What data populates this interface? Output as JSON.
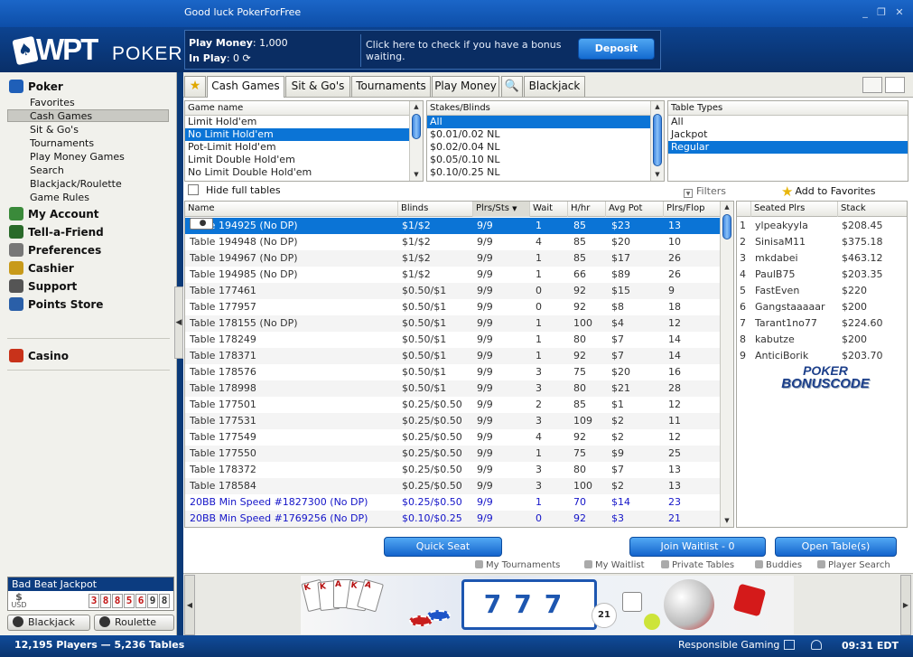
{
  "window": {
    "title": "Good luck PokerForFree",
    "minimize": "_",
    "restore": "❐",
    "close": "✕"
  },
  "brand": {
    "wpt": "WPT",
    "poker": "POKER"
  },
  "account": {
    "play_money_label": "Play Money",
    "play_money_value": "1,000",
    "in_play_label": "In Play",
    "in_play_value": "0",
    "bonus_text": "Click here to check if you have a bonus waiting.",
    "deposit_label": "Deposit"
  },
  "sidebar": {
    "poker": "Poker",
    "items": [
      "Favorites",
      "Cash Games",
      "Sit & Go's",
      "Tournaments",
      "Play Money Games",
      "Search",
      "Blackjack/Roulette",
      "Game Rules"
    ],
    "my_account": "My Account",
    "tell_a_friend": "Tell-a-Friend",
    "preferences": "Preferences",
    "cashier": "Cashier",
    "support": "Support",
    "points_store": "Points Store",
    "casino": "Casino",
    "jackpot": {
      "title": "Bad Beat Jackpot",
      "currency": "USD",
      "digits": [
        "3",
        "8",
        "8",
        "5",
        "6",
        "9",
        "8"
      ]
    },
    "blackjack_btn": "Blackjack",
    "roulette_btn": "Roulette"
  },
  "tabs": [
    "Cash Games",
    "Sit & Go's",
    "Tournaments",
    "Play Money",
    "Blackjack"
  ],
  "filters": {
    "game_header": "Game name",
    "games": [
      "Limit Hold'em",
      "No Limit Hold'em",
      "Pot-Limit Hold'em",
      "Limit Double Hold'em",
      "No Limit Double Hold'em"
    ],
    "game_selected": 1,
    "stakes_header": "Stakes/Blinds",
    "stakes": [
      "All",
      "$0.01/0.02 NL",
      "$0.02/0.04 NL",
      "$0.05/0.10 NL",
      "$0.10/0.25 NL"
    ],
    "stakes_selected": 0,
    "types_header": "Table Types",
    "types": [
      "All",
      "Jackpot",
      "Regular"
    ],
    "types_selected": 2
  },
  "hide_full_label": "Hide full tables",
  "filters_label": "Filters",
  "add_favorites_label": "Add to Favorites",
  "grid": {
    "headers": [
      "Name",
      "Blinds",
      "Plrs/Sts",
      "Wait",
      "H/hr",
      "Avg Pot",
      "Plrs/Flop"
    ],
    "rows": [
      {
        "name": "Table  194925 (No DP)",
        "blinds": "$1/$2",
        "plrs": "9/9",
        "wait": "1",
        "hhr": "85",
        "pot": "$23",
        "flop": "13"
      },
      {
        "name": "Table  194948 (No DP)",
        "blinds": "$1/$2",
        "plrs": "9/9",
        "wait": "4",
        "hhr": "85",
        "pot": "$20",
        "flop": "10"
      },
      {
        "name": "Table  194967 (No DP)",
        "blinds": "$1/$2",
        "plrs": "9/9",
        "wait": "1",
        "hhr": "85",
        "pot": "$17",
        "flop": "26"
      },
      {
        "name": "Table  194985 (No DP)",
        "blinds": "$1/$2",
        "plrs": "9/9",
        "wait": "1",
        "hhr": "66",
        "pot": "$89",
        "flop": "26"
      },
      {
        "name": "Table  177461",
        "blinds": "$0.50/$1",
        "plrs": "9/9",
        "wait": "0",
        "hhr": "92",
        "pot": "$15",
        "flop": "9"
      },
      {
        "name": "Table  177957",
        "blinds": "$0.50/$1",
        "plrs": "9/9",
        "wait": "0",
        "hhr": "92",
        "pot": "$8",
        "flop": "18"
      },
      {
        "name": "Table  178155 (No DP)",
        "blinds": "$0.50/$1",
        "plrs": "9/9",
        "wait": "1",
        "hhr": "100",
        "pot": "$4",
        "flop": "12"
      },
      {
        "name": "Table  178249",
        "blinds": "$0.50/$1",
        "plrs": "9/9",
        "wait": "1",
        "hhr": "80",
        "pot": "$7",
        "flop": "14"
      },
      {
        "name": "Table  178371",
        "blinds": "$0.50/$1",
        "plrs": "9/9",
        "wait": "1",
        "hhr": "92",
        "pot": "$7",
        "flop": "14"
      },
      {
        "name": "Table  178576",
        "blinds": "$0.50/$1",
        "plrs": "9/9",
        "wait": "3",
        "hhr": "75",
        "pot": "$20",
        "flop": "16"
      },
      {
        "name": "Table  178998",
        "blinds": "$0.50/$1",
        "plrs": "9/9",
        "wait": "3",
        "hhr": "80",
        "pot": "$21",
        "flop": "28"
      },
      {
        "name": "Table  177501",
        "blinds": "$0.25/$0.50",
        "plrs": "9/9",
        "wait": "2",
        "hhr": "85",
        "pot": "$1",
        "flop": "12"
      },
      {
        "name": "Table  177531",
        "blinds": "$0.25/$0.50",
        "plrs": "9/9",
        "wait": "3",
        "hhr": "109",
        "pot": "$2",
        "flop": "11"
      },
      {
        "name": "Table  177549",
        "blinds": "$0.25/$0.50",
        "plrs": "9/9",
        "wait": "4",
        "hhr": "92",
        "pot": "$2",
        "flop": "12"
      },
      {
        "name": "Table  177550",
        "blinds": "$0.25/$0.50",
        "plrs": "9/9",
        "wait": "1",
        "hhr": "75",
        "pot": "$9",
        "flop": "25"
      },
      {
        "name": "Table  178372",
        "blinds": "$0.25/$0.50",
        "plrs": "9/9",
        "wait": "3",
        "hhr": "80",
        "pot": "$7",
        "flop": "13"
      },
      {
        "name": "Table  178584",
        "blinds": "$0.25/$0.50",
        "plrs": "9/9",
        "wait": "3",
        "hhr": "100",
        "pot": "$2",
        "flop": "13"
      },
      {
        "name": "20BB Min Speed #1827300 (No DP)",
        "blinds": "$0.25/$0.50",
        "plrs": "9/9",
        "wait": "1",
        "hhr": "70",
        "pot": "$14",
        "flop": "23",
        "blue": true
      },
      {
        "name": "20BB Min Speed #1769256 (No DP)",
        "blinds": "$0.10/$0.25",
        "plrs": "9/9",
        "wait": "0",
        "hhr": "92",
        "pot": "$3",
        "flop": "21",
        "blue": true
      }
    ]
  },
  "seated": {
    "headers": [
      "Seated Plrs",
      "Stack"
    ],
    "rows": [
      {
        "seat": "1",
        "name": "ylpeakyyla",
        "stack": "$208.45"
      },
      {
        "seat": "2",
        "name": "SinisaM11",
        "stack": "$375.18"
      },
      {
        "seat": "3",
        "name": "mkdabei",
        "stack": "$463.12"
      },
      {
        "seat": "4",
        "name": "PaulB75",
        "stack": "$203.35"
      },
      {
        "seat": "5",
        "name": "FastEven",
        "stack": "$220"
      },
      {
        "seat": "6",
        "name": "Gangstaaaaar",
        "stack": "$200"
      },
      {
        "seat": "7",
        "name": "Tarant1no77",
        "stack": "$224.60"
      },
      {
        "seat": "8",
        "name": "kabutze",
        "stack": "$200"
      },
      {
        "seat": "9",
        "name": "AnticiBorik",
        "stack": "$203.70"
      }
    ],
    "watermark_l1": "POKER",
    "watermark_l2": "BONUSCODE"
  },
  "actions": {
    "quick_seat": "Quick Seat",
    "join_waitlist": "Join Waitlist - 0",
    "open_tables": "Open Table(s)"
  },
  "links": [
    "My Tournaments",
    "My Waitlist",
    "Private Tables",
    "Buddies",
    "Player Search"
  ],
  "status": {
    "counts": "12,195 Players  —  5,236 Tables",
    "responsible": "Responsible Gaming",
    "clock": "09:31 EDT"
  },
  "colors": {
    "accent": "#0b74d6",
    "header": "#0c4390"
  }
}
